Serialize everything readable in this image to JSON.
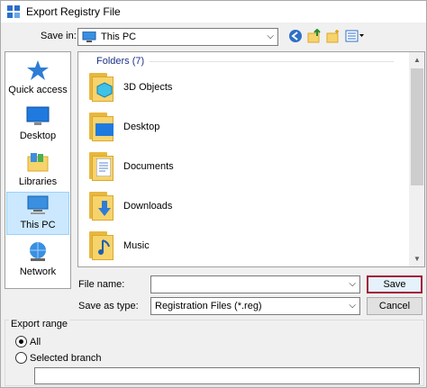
{
  "window": {
    "title": "Export Registry File"
  },
  "save_in": {
    "label": "Save in:",
    "value": "This PC"
  },
  "places": [
    {
      "label": "Quick access",
      "icon": "quick-access-star-icon"
    },
    {
      "label": "Desktop",
      "icon": "desktop-icon"
    },
    {
      "label": "Libraries",
      "icon": "libraries-icon"
    },
    {
      "label": "This PC",
      "icon": "this-pc-icon",
      "selected": true
    },
    {
      "label": "Network",
      "icon": "network-icon"
    }
  ],
  "file_list": {
    "group_header": "Folders (7)",
    "items": [
      {
        "name": "3D Objects",
        "icon": "3d-objects-folder-icon"
      },
      {
        "name": "Desktop",
        "icon": "desktop-folder-icon"
      },
      {
        "name": "Documents",
        "icon": "documents-folder-icon"
      },
      {
        "name": "Downloads",
        "icon": "downloads-folder-icon"
      },
      {
        "name": "Music",
        "icon": "music-folder-icon"
      }
    ]
  },
  "form": {
    "file_name_label": "File name:",
    "file_name_value": "",
    "save_as_type_label": "Save as type:",
    "save_as_type_value": "Registration Files (*.reg)",
    "save_button": "Save",
    "cancel_button": "Cancel"
  },
  "export_range": {
    "legend": "Export range",
    "all_label": "All",
    "selected_branch_label": "Selected branch",
    "selected_option": "All",
    "branch_value": ""
  },
  "colors": {
    "accent_selection": "#cce8ff",
    "default_button_border": "#a0183a",
    "folder_yellow": "#f7d36b",
    "group_header_text": "#1e3287"
  }
}
